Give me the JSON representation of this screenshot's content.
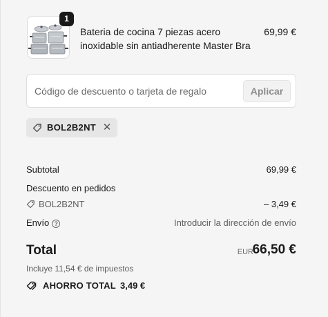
{
  "product": {
    "title": "Bateria de cocina 7 piezas acero inoxidable sin antiadherente Master Bra",
    "price": "69,99 €",
    "quantity": "1",
    "image_icon": "cookware-set-image"
  },
  "discount": {
    "placeholder": "Código de descuento o tarjeta de regalo",
    "value": "",
    "apply_label": "Aplicar",
    "applied_code": "BOL2B2NT"
  },
  "summary": {
    "subtotal_label": "Subtotal",
    "subtotal_value": "69,99 €",
    "order_discount_label": "Descuento en pedidos",
    "order_discount_code": "BOL2B2NT",
    "order_discount_value": "– 3,49 €",
    "shipping_label": "Envío",
    "shipping_value": "Introducir la dirección de envío",
    "total_label": "Total",
    "total_currency": "EUR",
    "total_value": "66,50 €",
    "tax_note": "Incluye 11,54 € de impuestos",
    "savings_label": "AHORRO TOTAL",
    "savings_value": "3,49 €"
  },
  "colors": {
    "background": "#f5f5f5",
    "text": "#1a1a1a",
    "muted": "#5e5e5e",
    "chip": "#e6e6e6"
  }
}
